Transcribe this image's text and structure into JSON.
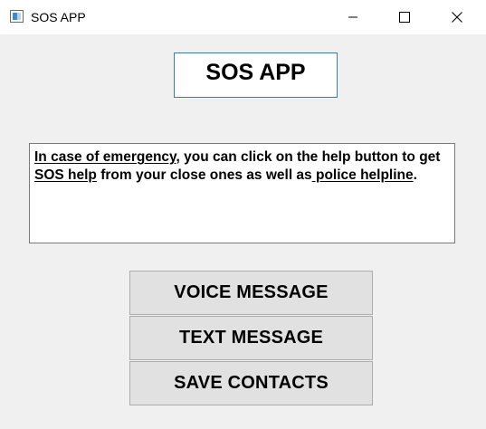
{
  "window": {
    "title": "SOS APP"
  },
  "header": {
    "title": "SOS APP"
  },
  "info": {
    "part1": "In case of emergency",
    "part2": ", you can click on the help button to get ",
    "part3": "SOS help",
    "part4": " from your close ones as well as",
    "part5": " police helpline",
    "part6": "."
  },
  "buttons": {
    "voice_message": "VOICE MESSAGE",
    "text_message": "TEXT MESSAGE",
    "save_contacts": "SAVE CONTACTS"
  },
  "icons": {
    "app": "app-window-icon",
    "minimize": "minimize-icon",
    "maximize": "maximize-icon",
    "close": "close-icon"
  },
  "colors": {
    "window_bg": "#f0f0f0",
    "button_bg": "#e1e1e1",
    "header_border": "#3e7ca8"
  }
}
